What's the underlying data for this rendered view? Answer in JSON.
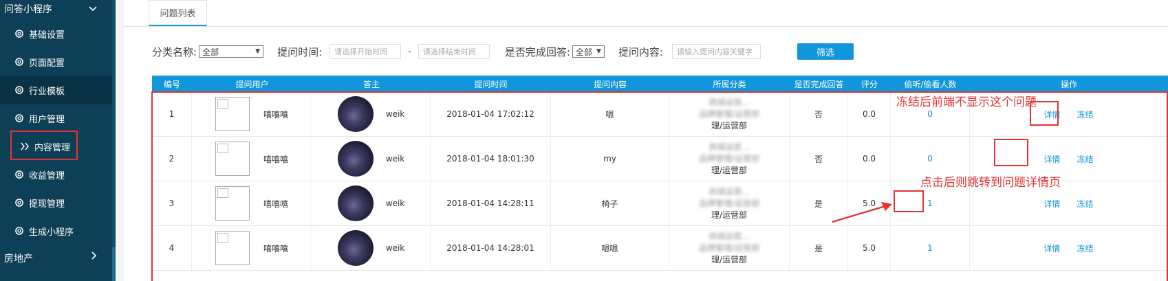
{
  "sidebar": {
    "section_title": "问答小程序",
    "items": [
      {
        "label": "基础设置",
        "icon": "gear-icon"
      },
      {
        "label": "页面配置",
        "icon": "gear-icon"
      },
      {
        "label": "行业模板",
        "icon": "gear-icon"
      },
      {
        "label": "用户管理",
        "icon": "gear-icon"
      },
      {
        "label": "内容管理",
        "icon": "double-chevron-right-icon"
      },
      {
        "label": "收益管理",
        "icon": "gear-icon"
      },
      {
        "label": "提现管理",
        "icon": "gear-icon"
      },
      {
        "label": "生成小程序",
        "icon": "gear-icon"
      }
    ],
    "footer_title": "房地产"
  },
  "tab": {
    "label": "问题列表"
  },
  "filters": {
    "category_label": "分类名称:",
    "category_value": "全部",
    "time_label": "提问时间:",
    "start_placeholder": "请选择开始时间",
    "separator": "-",
    "end_placeholder": "请选择结束时间",
    "done_label": "是否完成回答:",
    "done_value": "全部",
    "content_label": "提问内容:",
    "content_placeholder": "请输入提问内容关键字",
    "filter_button": "筛选"
  },
  "table": {
    "headers": [
      "编号",
      "提问用户",
      "答主",
      "提问时间",
      "提问内容",
      "所属分类",
      "是否完成回答",
      "评分",
      "偷听/偷看人数",
      "操作"
    ],
    "rows": [
      {
        "id": "1",
        "asker": "嘻嘻嘻",
        "answerer": "weik",
        "time": "2018-01-04 17:02:12",
        "content": "嗯",
        "category_top": "商城运营...",
        "category_mid": "品牌管理/运营部",
        "category_bottom": "理/运营部",
        "done": "否",
        "score": "0.0",
        "views": "0",
        "detail": "详情",
        "freeze": "冻结"
      },
      {
        "id": "2",
        "asker": "嘻嘻嘻",
        "answerer": "weik",
        "time": "2018-01-04 18:01:30",
        "content": "my",
        "category_top": "商城运营...",
        "category_mid": "品牌管理/运营部",
        "category_bottom": "理/运营部",
        "done": "否",
        "score": "0.0",
        "views": "0",
        "detail": "详情",
        "freeze": "冻结"
      },
      {
        "id": "3",
        "asker": "嘻嘻嘻",
        "answerer": "weik",
        "time": "2018-01-04 14:28:11",
        "content": "椅子",
        "category_top": "商城运营...",
        "category_mid": "品牌管理/运营部",
        "category_bottom": "理/运营部",
        "done": "是",
        "score": "5.0",
        "views": "1",
        "detail": "详情",
        "freeze": "冻结"
      },
      {
        "id": "4",
        "asker": "嘻嘻嘻",
        "answerer": "weik",
        "time": "2018-01-04 14:28:01",
        "content": "嗯嗯",
        "category_top": "商城运营...",
        "category_mid": "品牌管理/运营部",
        "category_bottom": "理/运营部",
        "done": "是",
        "score": "5.0",
        "views": "1",
        "detail": "详情",
        "freeze": "冻结"
      }
    ]
  },
  "annotations": {
    "freeze_note": "冻结后前端不显示这个问题",
    "detail_note": "点击后则跳转到问题详情页"
  },
  "colors": {
    "accent": "#1296db",
    "annotation": "#e53333",
    "sidebar": "#0d3f57"
  }
}
